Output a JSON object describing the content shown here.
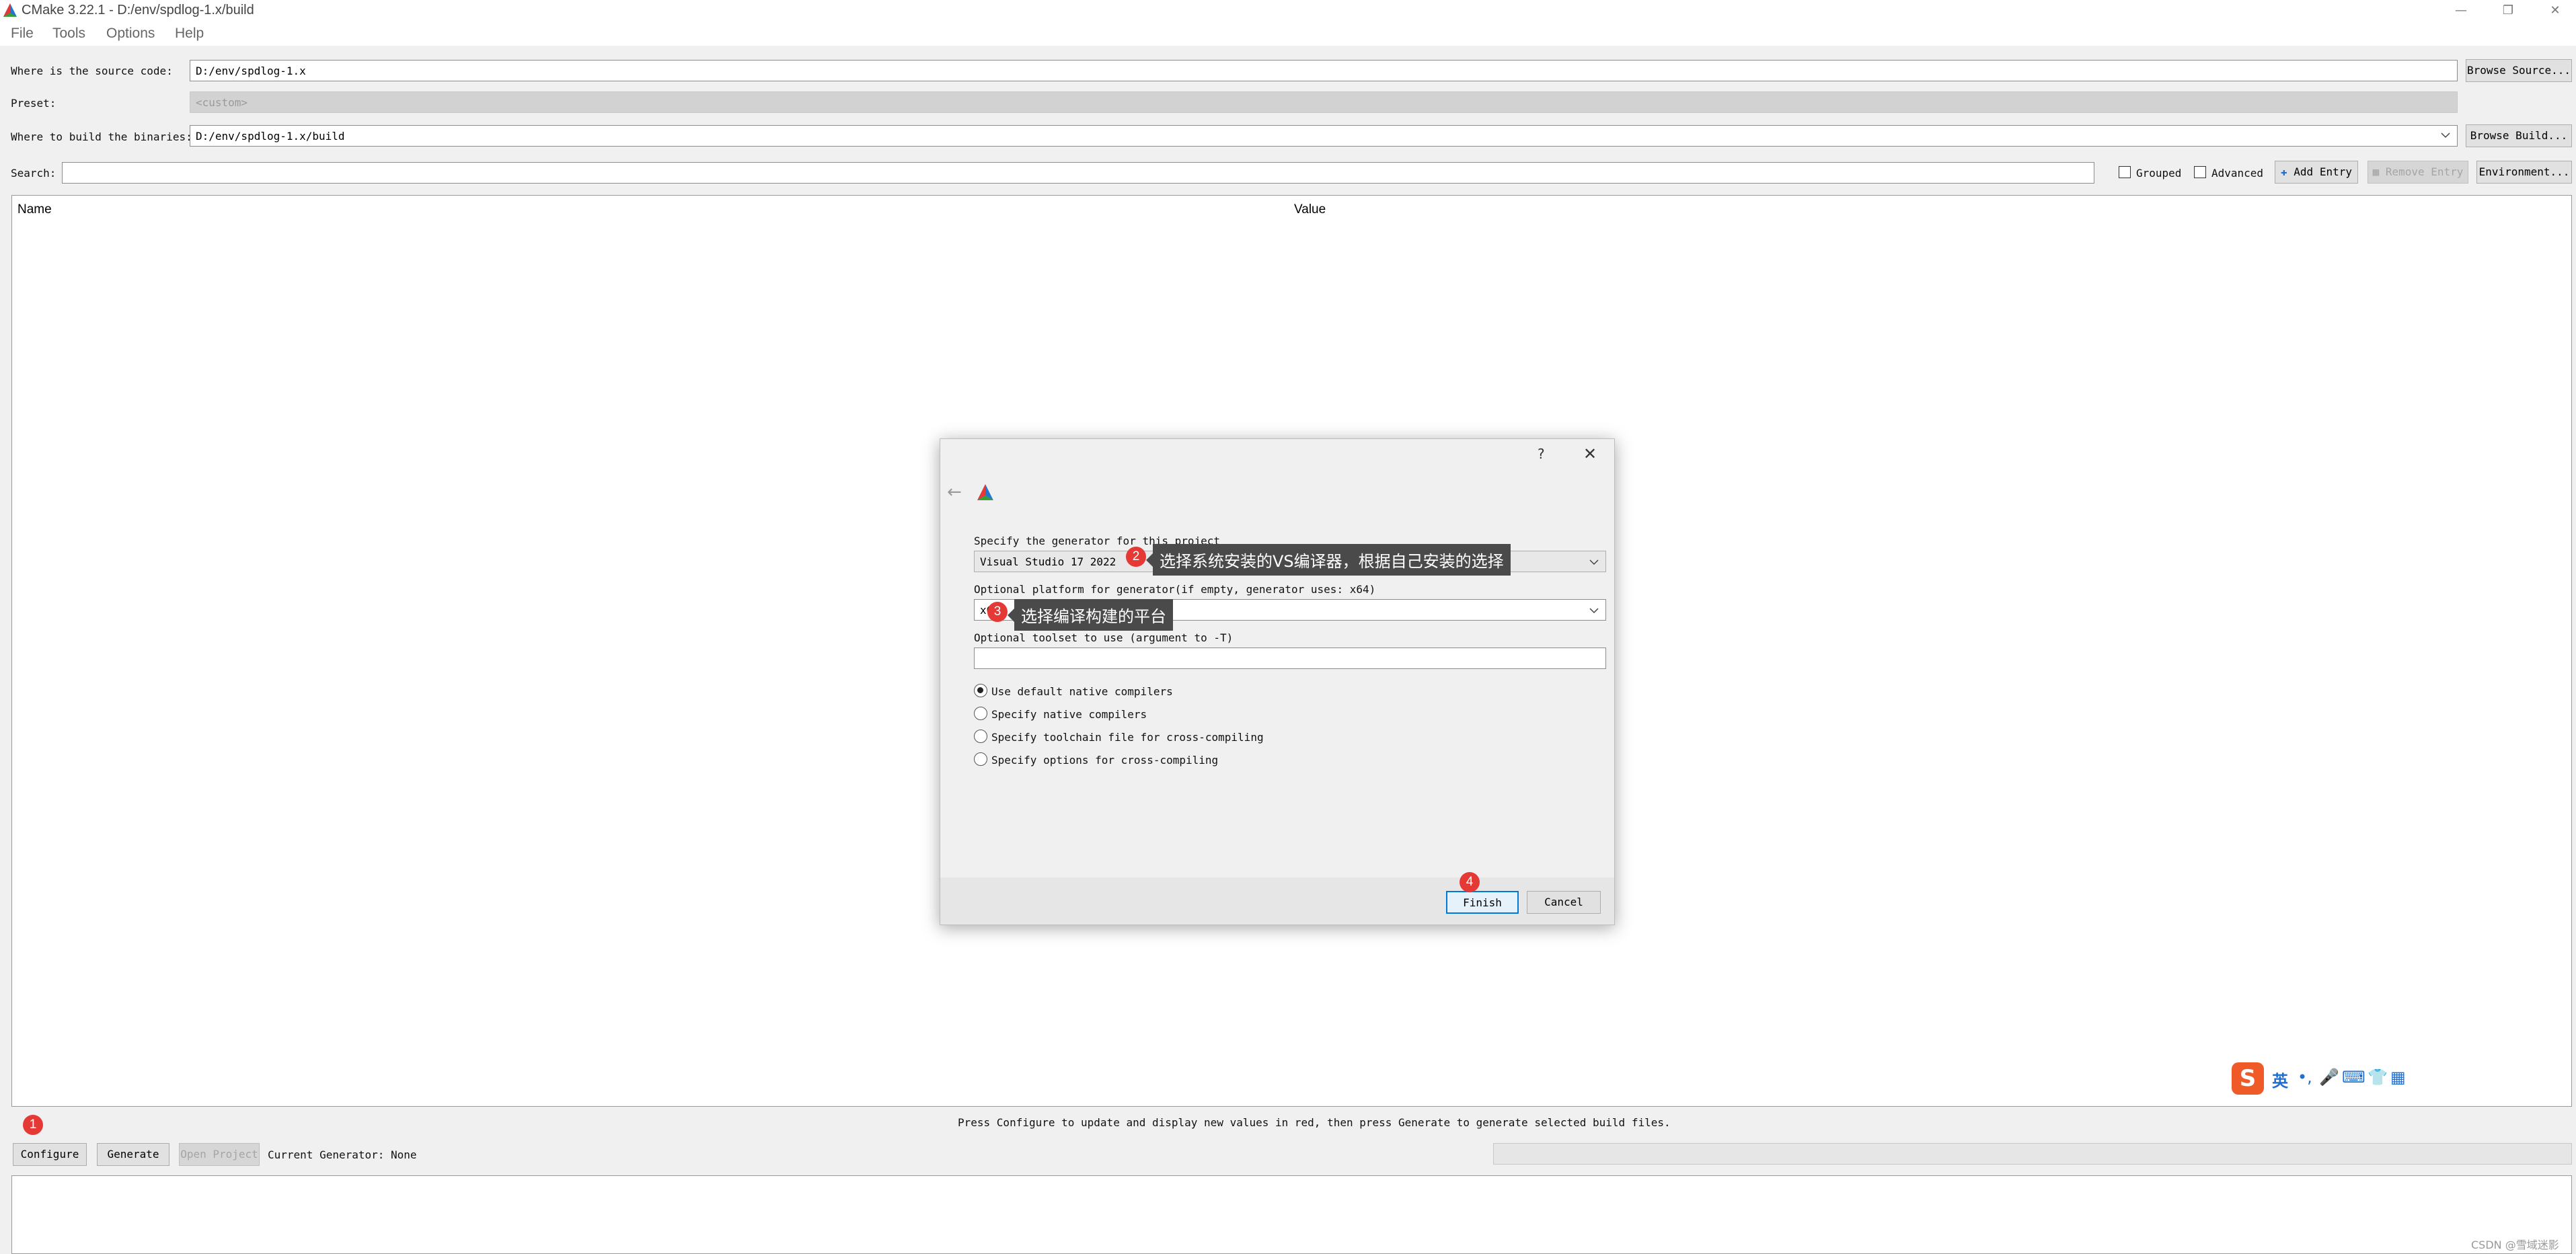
{
  "window": {
    "title": "CMake 3.22.1 - D:/env/spdlog-1.x/build",
    "controls": {
      "minimize": "—",
      "restore": "❐",
      "close": "✕"
    }
  },
  "menu": [
    "File",
    "Tools",
    "Options",
    "Help"
  ],
  "source": {
    "label": "Where is the source code:",
    "value": "D:/env/spdlog-1.x",
    "button": "Browse Source..."
  },
  "preset": {
    "label": "Preset:",
    "value": "<custom>"
  },
  "build": {
    "label": "Where to build the binaries:",
    "value": "D:/env/spdlog-1.x/build",
    "button": "Browse Build..."
  },
  "search": {
    "label": "Search:",
    "value": ""
  },
  "options": {
    "grouped": "Grouped",
    "advanced": "Advanced",
    "add_entry": "Add Entry",
    "remove_entry": "Remove Entry",
    "environment": "Environment..."
  },
  "table": {
    "columns": [
      "Name",
      "Value"
    ]
  },
  "status_message": "Press Configure to update and display new values in red, then press Generate to generate selected build files.",
  "bottom": {
    "configure": "Configure",
    "generate": "Generate",
    "open_project": "Open Project",
    "current_generator": "Current Generator: None",
    "progress": 0
  },
  "badges": {
    "b1": "1",
    "b2": "2",
    "b3": "3",
    "b4": "4"
  },
  "dialog": {
    "help": "?",
    "close": "✕",
    "back": "←",
    "generator_label": "Specify the generator for this project",
    "generator_value": "Visual Studio 17 2022",
    "platform_label": "Optional platform for generator(if empty, generator uses: x64)",
    "platform_value": "x64",
    "toolset_label": "Optional toolset to use (argument to -T)",
    "toolset_value": "",
    "radios": [
      {
        "label": "Use default native compilers",
        "checked": true
      },
      {
        "label": "Specify native compilers",
        "checked": false
      },
      {
        "label": "Specify toolchain file for cross-compiling",
        "checked": false
      },
      {
        "label": "Specify options for cross-compiling",
        "checked": false
      }
    ],
    "finish": "Finish",
    "cancel": "Cancel",
    "tooltip_generator": "选择系统安装的VS编译器，根据自己安装的选择",
    "tooltip_platform": "选择编译构建的平台"
  },
  "ime": {
    "lang": "英"
  },
  "watermark": "CSDN @雪域迷影",
  "colors": {
    "badge": "#e53935",
    "tooltip": "#4a4a4a",
    "finish_border": "#0078d7",
    "ime_logo": "#f05a28"
  }
}
